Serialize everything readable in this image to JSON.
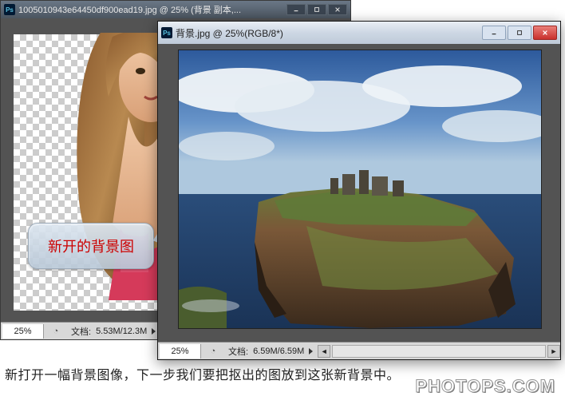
{
  "window1": {
    "title": "1005010943e64450df900ead19.jpg @ 25% (背景 副本,...",
    "zoom": "25%",
    "doc_label": "文档:",
    "doc_size": "5.53M/12.3M"
  },
  "window2": {
    "title": "背景.jpg @ 25%(RGB/8*)",
    "zoom": "25%",
    "doc_label": "文档:",
    "doc_size": "6.59M/6.59M"
  },
  "callout": {
    "text": "新开的背景图"
  },
  "caption": {
    "text": "新打开一幅背景图像，下一步我们要把抠出的图放到这张新背景中。"
  },
  "watermark": {
    "text": "PHOTOPS.COM"
  },
  "icons": {
    "ps": "Ps"
  }
}
